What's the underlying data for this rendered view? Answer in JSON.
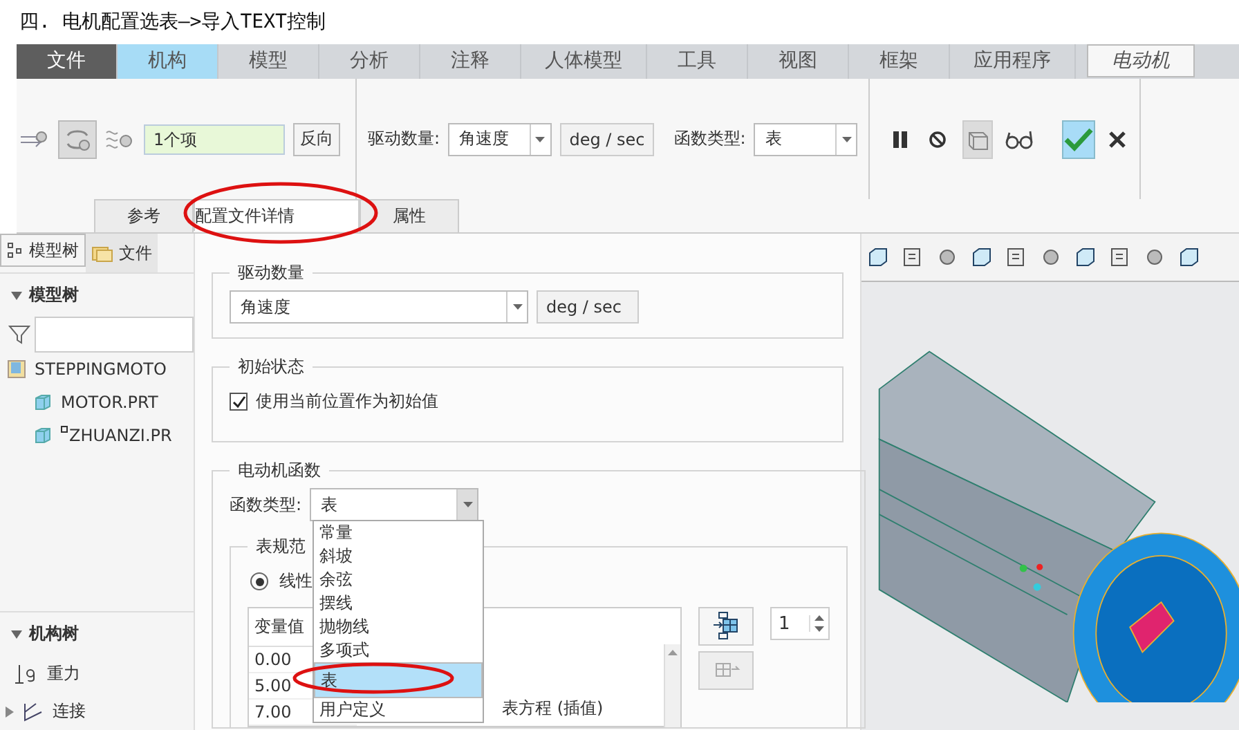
{
  "title": "四. 电机配置选表—>导入TEXT控制",
  "ribbon_tabs": [
    {
      "label": "文件",
      "kind": "file",
      "selected": false
    },
    {
      "label": "机构",
      "kind": "group",
      "selected": false
    },
    {
      "label": "模型",
      "kind": "normal",
      "selected": false
    },
    {
      "label": "分析",
      "kind": "normal",
      "selected": false
    },
    {
      "label": "注释",
      "kind": "normal",
      "selected": false
    },
    {
      "label": "人体模型",
      "kind": "normal",
      "selected": false
    },
    {
      "label": "工具",
      "kind": "normal",
      "selected": false
    },
    {
      "label": "视图",
      "kind": "normal",
      "selected": false
    },
    {
      "label": "框架",
      "kind": "normal",
      "selected": false
    },
    {
      "label": "应用程序",
      "kind": "normal",
      "selected": false
    },
    {
      "label": "电动机",
      "kind": "context",
      "selected": true
    }
  ],
  "ribbon": {
    "references": {
      "value": "1个项"
    },
    "reverse_button": "反向",
    "drive_quantity": {
      "label": "驱动数量:",
      "value": "角速度",
      "unit": "deg / sec"
    },
    "function_type": {
      "label": "函数类型:",
      "value": "表"
    },
    "tools": [
      {
        "kind": "pause",
        "selected": false
      },
      {
        "kind": "stop",
        "selected": false
      },
      {
        "kind": "preview",
        "selected": true
      },
      {
        "kind": "glasses",
        "selected": false
      }
    ]
  },
  "panel_tabs": [
    {
      "label": "参考",
      "selected": false
    },
    {
      "label": "配置文件详情",
      "selected": true
    },
    {
      "label": "属性",
      "selected": false
    }
  ],
  "left_panel": {
    "tabs": [
      {
        "label": "模型树",
        "selected": true
      },
      {
        "label": "文件",
        "selected": false
      }
    ],
    "model_tree": {
      "header": "模型树",
      "items": [
        {
          "label": "STEPPINGMOTO",
          "kind": "assembly",
          "children": [
            {
              "label": "MOTOR.PRT",
              "kind": "part"
            },
            {
              "label": "ZHUANZI.PR",
              "kind": "part"
            }
          ]
        }
      ]
    },
    "mechanism_tree": {
      "header": "机构树",
      "items": [
        {
          "label": "重力",
          "kind": "gravity"
        },
        {
          "label": "连接",
          "kind": "connections"
        }
      ]
    }
  },
  "dialog": {
    "drive_quantity": {
      "legend": "驱动数量",
      "value": "角速度",
      "unit": "deg / sec"
    },
    "initial_state": {
      "legend": "初始状态",
      "checkbox": {
        "label": "使用当前位置作为初始值",
        "checked": true
      }
    },
    "motor_function": {
      "legend": "电动机函数",
      "type_label": "函数类型:",
      "type_value": "表",
      "options": [
        {
          "label": "常量",
          "selected": false
        },
        {
          "label": "斜坡",
          "selected": false
        },
        {
          "label": "余弦",
          "selected": false
        },
        {
          "label": "摆线",
          "selected": false
        },
        {
          "label": "抛物线",
          "selected": false
        },
        {
          "label": "多项式",
          "selected": false
        },
        {
          "label": "表",
          "selected": true
        },
        {
          "label": "用户定义",
          "selected": false
        }
      ],
      "table_spec": {
        "legend": "表规范",
        "radio": {
          "label": "线性",
          "selected": true
        },
        "column": "变量值",
        "rows": [
          "0.00",
          "5.00",
          "7.00"
        ],
        "spin_value": "1",
        "method_label": "表方程 (插值)"
      }
    }
  }
}
